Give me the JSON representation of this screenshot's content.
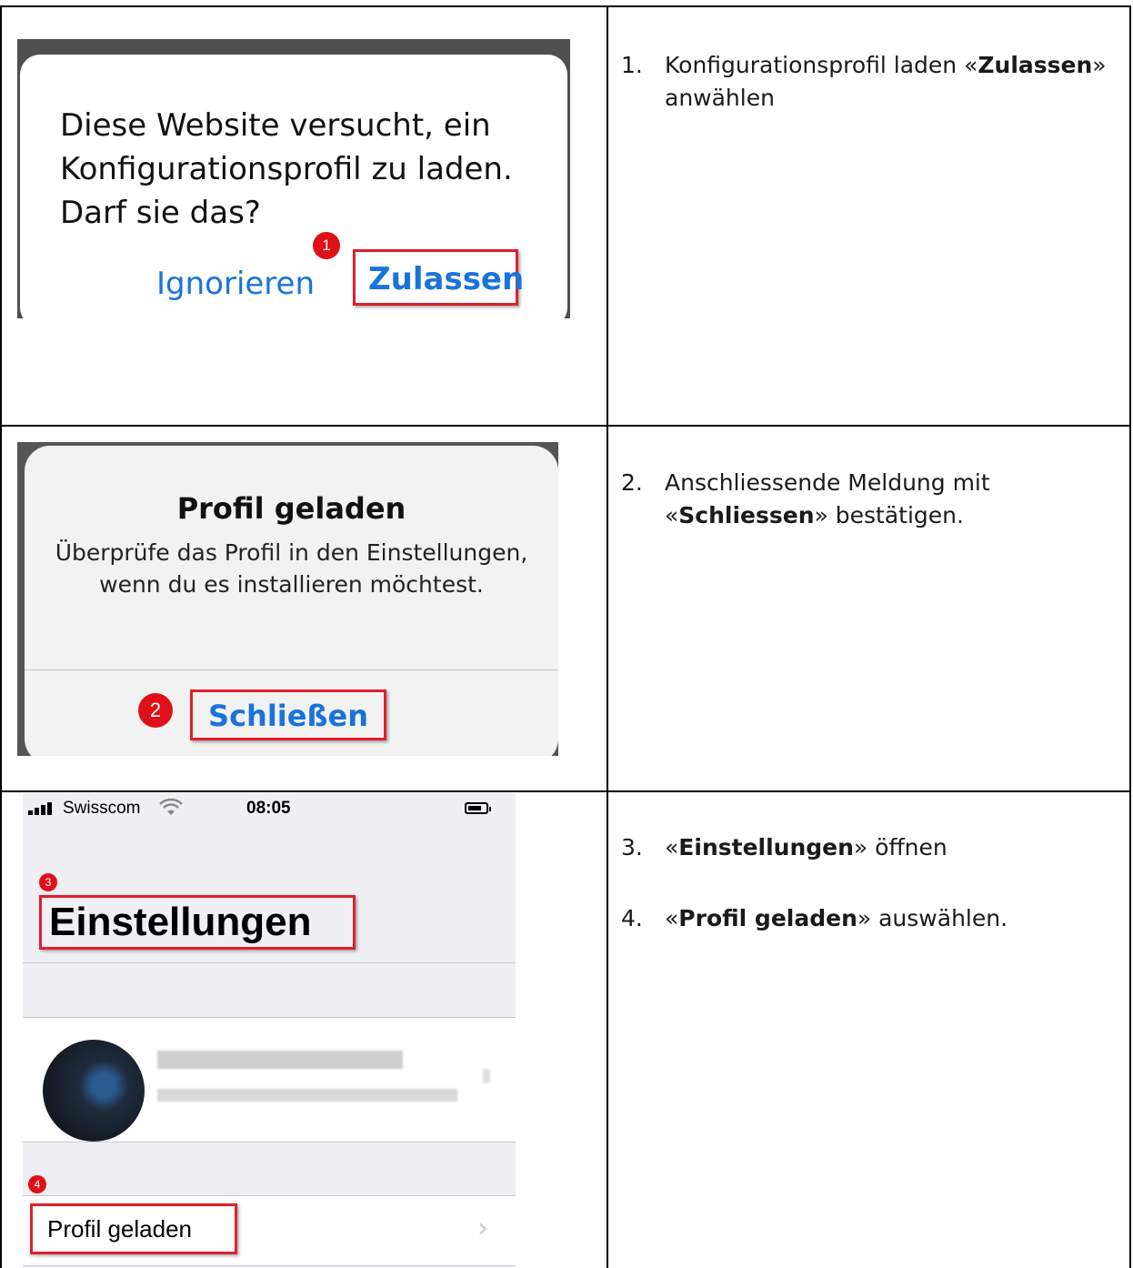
{
  "shot1": {
    "message": "Diese Website versucht, ein Konfigurationsprofil zu laden. Darf sie das?",
    "ignore_label": "Ignorieren",
    "allow_label": "Zulassen",
    "badge": "1"
  },
  "shot2": {
    "title": "Profil geladen",
    "body": "Überprüfe das Profil in den Einstellungen, wenn du es installieren möchtest.",
    "close_label": "Schließen",
    "badge": "2"
  },
  "shot3": {
    "carrier": "Swisscom",
    "time": "08:05",
    "title": "Einstellungen",
    "row_label": "Profil geladen",
    "badge_title": "3",
    "badge_row": "4"
  },
  "steps": [
    {
      "num": "1.",
      "pre": "Konfigurationsprofil laden «",
      "bold": "Zulassen",
      "post": "» anwählen"
    },
    {
      "num": "2.",
      "pre": "Anschliessende Meldung mit «",
      "bold": "Schliessen",
      "post": "» bestätigen."
    },
    {
      "num": "3.",
      "pre": "«",
      "bold": "Einstellungen",
      "post": "» öffnen"
    },
    {
      "num": "4.",
      "pre": "«",
      "bold": "Profil geladen",
      "post": "» auswählen."
    }
  ],
  "colors": {
    "ios_blue": "#1a73d9",
    "highlight_red": "#e0202a",
    "badge_red": "#e01018"
  }
}
